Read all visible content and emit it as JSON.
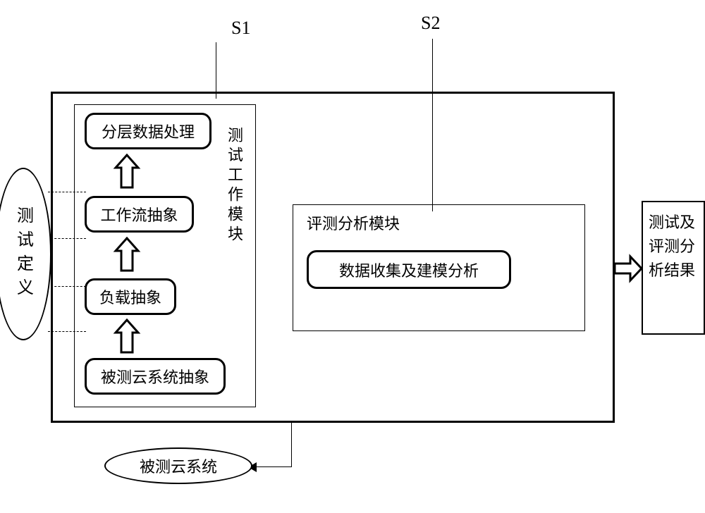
{
  "labels": {
    "s1": "S1",
    "s2": "S2"
  },
  "left_ellipse": "测试定义",
  "test_work_module": {
    "title": "测试工作模块",
    "stages": {
      "s_top": "分层数据处理",
      "s_mid1": "工作流抽象",
      "s_mid2": "负载抽象",
      "s_bottom": "被测云系统抽象"
    }
  },
  "eval_module": {
    "title": "评测分析模块",
    "inner": "数据收集及建模分析"
  },
  "output_box": "测试及评测分析结果",
  "bottom_ellipse": "被测云系统"
}
